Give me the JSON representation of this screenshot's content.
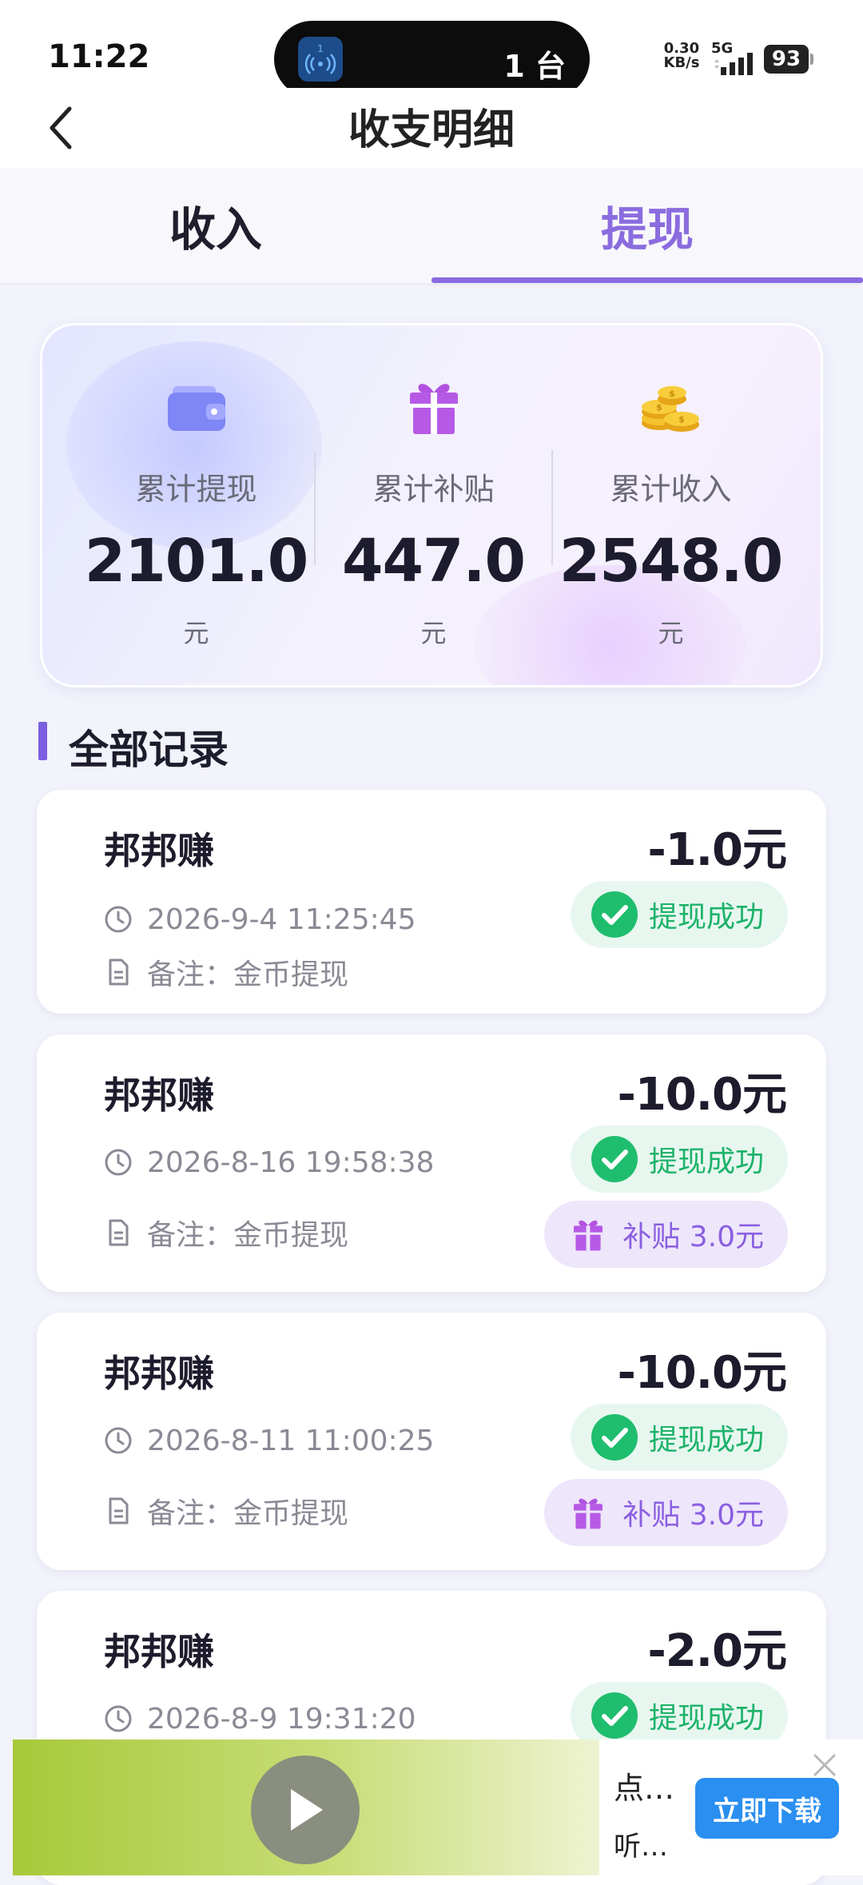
{
  "status_bar": {
    "time": "11:22",
    "island_badge": "1",
    "island_text": "1 台",
    "net_speed_value": "0.30",
    "net_speed_unit": "KB/s",
    "network": "5G",
    "battery": "93"
  },
  "header": {
    "title": "收支明细"
  },
  "tabs": [
    {
      "label": "收入",
      "active": false
    },
    {
      "label": "提现",
      "active": true
    }
  ],
  "summary": [
    {
      "label": "累计提现",
      "value": "2101.0",
      "unit": "元",
      "icon": "wallet-icon"
    },
    {
      "label": "累计补贴",
      "value": "447.0",
      "unit": "元",
      "icon": "gift-icon"
    },
    {
      "label": "累计收入",
      "value": "2548.0",
      "unit": "元",
      "icon": "coins-icon"
    }
  ],
  "section": {
    "title": "全部记录"
  },
  "records": [
    {
      "name": "邦邦赚",
      "amount": "-1.0元",
      "time": "2026-9-4 11:25:45",
      "note": "备注：金币提现",
      "status": "提现成功"
    },
    {
      "name": "邦邦赚",
      "amount": "-10.0元",
      "time": "2026-8-16 19:58:38",
      "note": "备注：金币提现",
      "status": "提现成功",
      "subsidy": "补贴 3.0元"
    },
    {
      "name": "邦邦赚",
      "amount": "-10.0元",
      "time": "2026-8-11 11:00:25",
      "note": "备注：金币提现",
      "status": "提现成功",
      "subsidy": "补贴 3.0元"
    },
    {
      "name": "邦邦赚",
      "amount": "-2.0元",
      "time": "2026-8-9 19:31:20",
      "status": "提现成功"
    }
  ],
  "ad": {
    "line1": "点…",
    "line2": "听…",
    "button": "立即下载"
  },
  "colors": {
    "accent": "#8a6be2",
    "success": "#1db26a",
    "subsidy": "#8a5fe0",
    "ad_button": "#2a8ff0"
  }
}
